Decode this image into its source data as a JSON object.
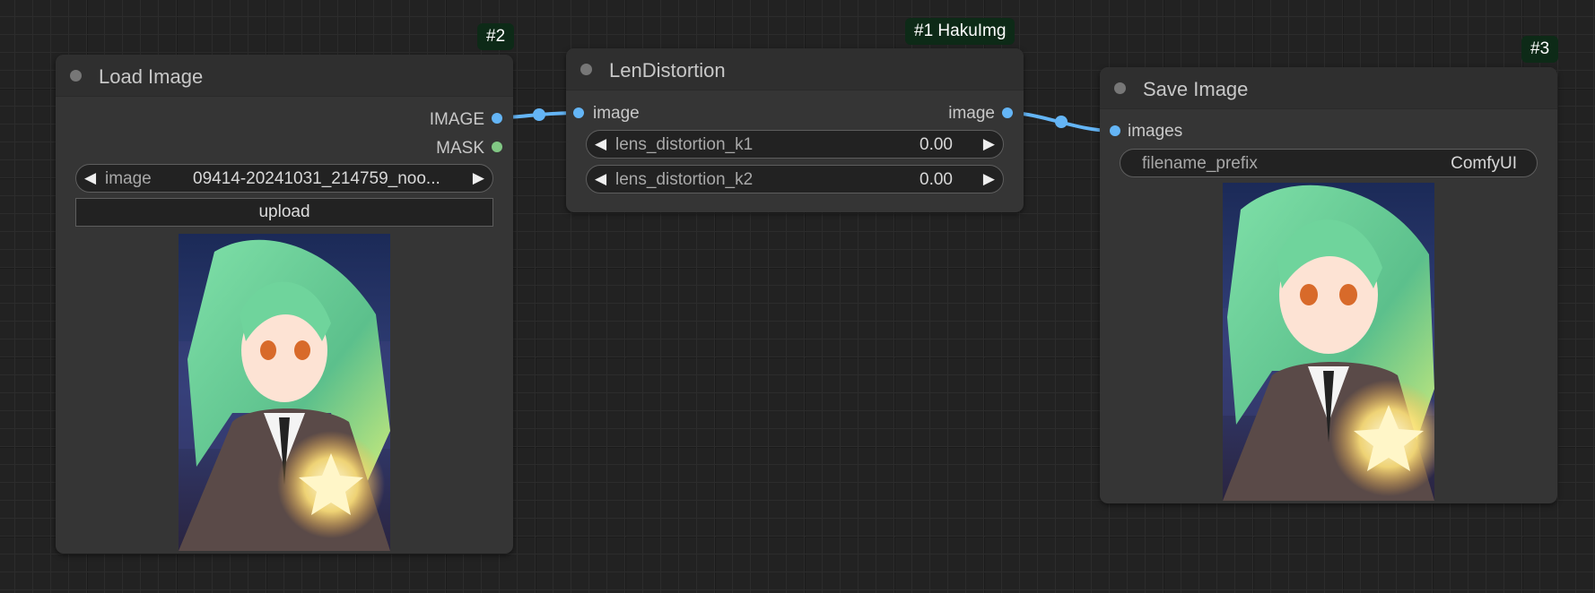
{
  "nodes": {
    "load_image": {
      "badge": "#2",
      "title": "Load Image",
      "outputs": [
        "IMAGE",
        "MASK"
      ],
      "image_widget": {
        "label": "image",
        "value": "09414-20241031_214759_noo..."
      },
      "upload_label": "upload",
      "preview_image": "anime girl with green hair and a glowing star"
    },
    "len_distortion": {
      "badge": "#1 HakuImg",
      "title": "LenDistortion",
      "input": "image",
      "output": "image",
      "widgets": [
        {
          "label": "lens_distortion_k1",
          "value": "0.00"
        },
        {
          "label": "lens_distortion_k2",
          "value": "0.00"
        }
      ]
    },
    "save_image": {
      "badge": "#3",
      "title": "Save Image",
      "input": "images",
      "filename_widget": {
        "label": "filename_prefix",
        "value": "ComfyUI"
      },
      "preview_image": "anime girl with green hair and a glowing star"
    }
  },
  "arrows": {
    "left": "◀",
    "right": "▶"
  },
  "colors": {
    "image_slot": "#64b5f6",
    "mask_slot": "#81c784",
    "link": "#64b5f6",
    "badge_bg": "#0d2a17"
  }
}
